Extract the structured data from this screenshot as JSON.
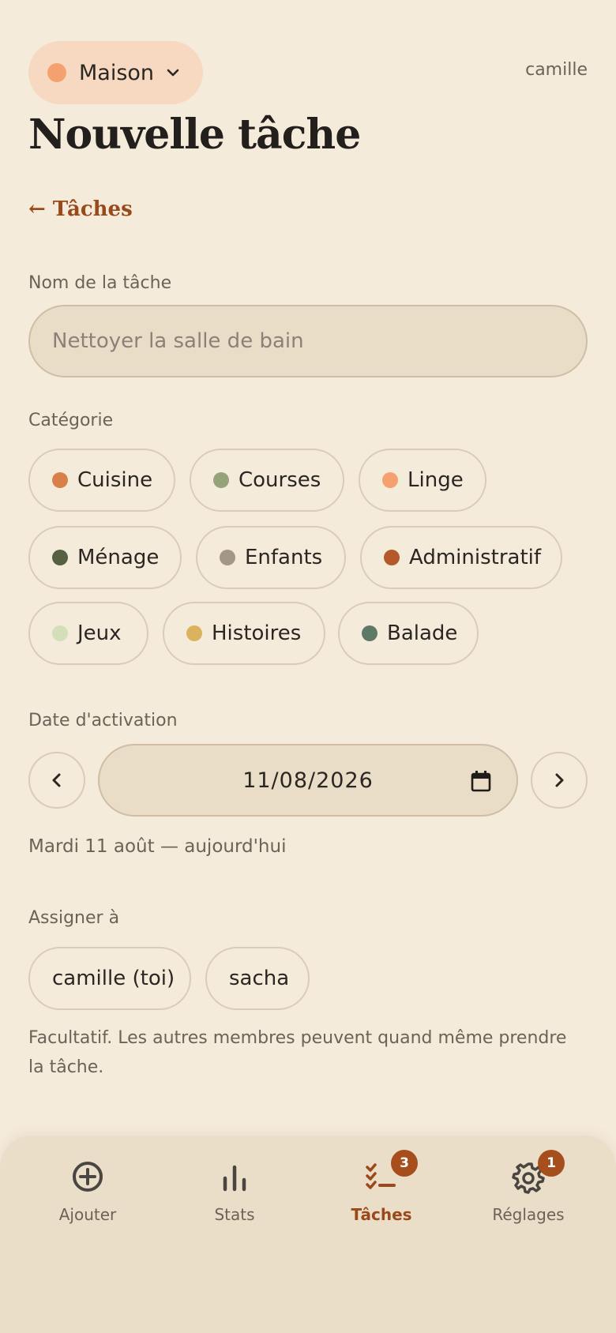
{
  "header": {
    "household_name": "Maison",
    "household_color": "#f4a06f",
    "username": "camille",
    "title": "Nouvelle tâche",
    "back_label": "← Tâches"
  },
  "form": {
    "task_name": {
      "label": "Nom de la tâche",
      "placeholder": "Nettoyer la salle de bain",
      "value": ""
    },
    "category": {
      "label": "Catégorie",
      "options": [
        {
          "label": "Cuisine",
          "color": "#d9804a"
        },
        {
          "label": "Courses",
          "color": "#94a378"
        },
        {
          "label": "Linge",
          "color": "#f4a06f"
        },
        {
          "label": "Ménage",
          "color": "#556140"
        },
        {
          "label": "Enfants",
          "color": "#a39888"
        },
        {
          "label": "Administratif",
          "color": "#b5592a"
        },
        {
          "label": "Jeux",
          "color": "#d3dfb8"
        },
        {
          "label": "Histoires",
          "color": "#dbb35e"
        },
        {
          "label": "Balade",
          "color": "#5e7a67"
        }
      ]
    },
    "activation_date": {
      "label": "Date d'activation",
      "value": "11/08/2026",
      "hint": "Mardi 11 août — aujourd'hui"
    },
    "assign": {
      "label": "Assigner à",
      "options": [
        "camille (toi)",
        "sacha"
      ],
      "hint": "Facultatif. Les autres membres peuvent quand même prendre la tâche."
    }
  },
  "tabbar": {
    "items": [
      {
        "label": "Ajouter",
        "icon": "plus-circle-icon"
      },
      {
        "label": "Stats",
        "icon": "bar-chart-icon"
      },
      {
        "label": "Tâches",
        "icon": "task-list-icon",
        "badge": "3",
        "active": true
      },
      {
        "label": "Réglages",
        "icon": "gear-icon",
        "badge": "1"
      }
    ]
  },
  "colors": {
    "background": "#f5ebdb",
    "accent": "#9a4a1a",
    "badge": "#a64f1c"
  }
}
